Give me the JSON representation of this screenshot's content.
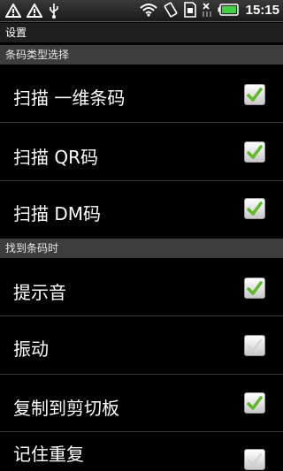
{
  "status_bar": {
    "time": "15:15",
    "left_icons": [
      "warning-icon",
      "warning-icon",
      "usb-icon"
    ],
    "right_icons": [
      "wifi-icon",
      "vibrate-icon",
      "sim-icon",
      "no-signal-icon",
      "battery-icon"
    ],
    "battery_color": "#3fcf3f"
  },
  "title": "设置",
  "sections": [
    {
      "header": "条码类型选择",
      "items": [
        {
          "label": "扫描 一维条码",
          "checked": true
        },
        {
          "label": "扫描 QR码",
          "checked": true
        },
        {
          "label": "扫描 DM码",
          "checked": true
        }
      ]
    },
    {
      "header": "找到条码时",
      "items": [
        {
          "label": "提示音",
          "checked": true
        },
        {
          "label": "振动",
          "checked": false
        },
        {
          "label": "复制到剪切板",
          "checked": true
        },
        {
          "label": "记住重复",
          "checked": false
        }
      ]
    }
  ],
  "colors": {
    "check_green": "#5fb82a",
    "background": "#000000",
    "section_header": "#3d3d3d"
  }
}
